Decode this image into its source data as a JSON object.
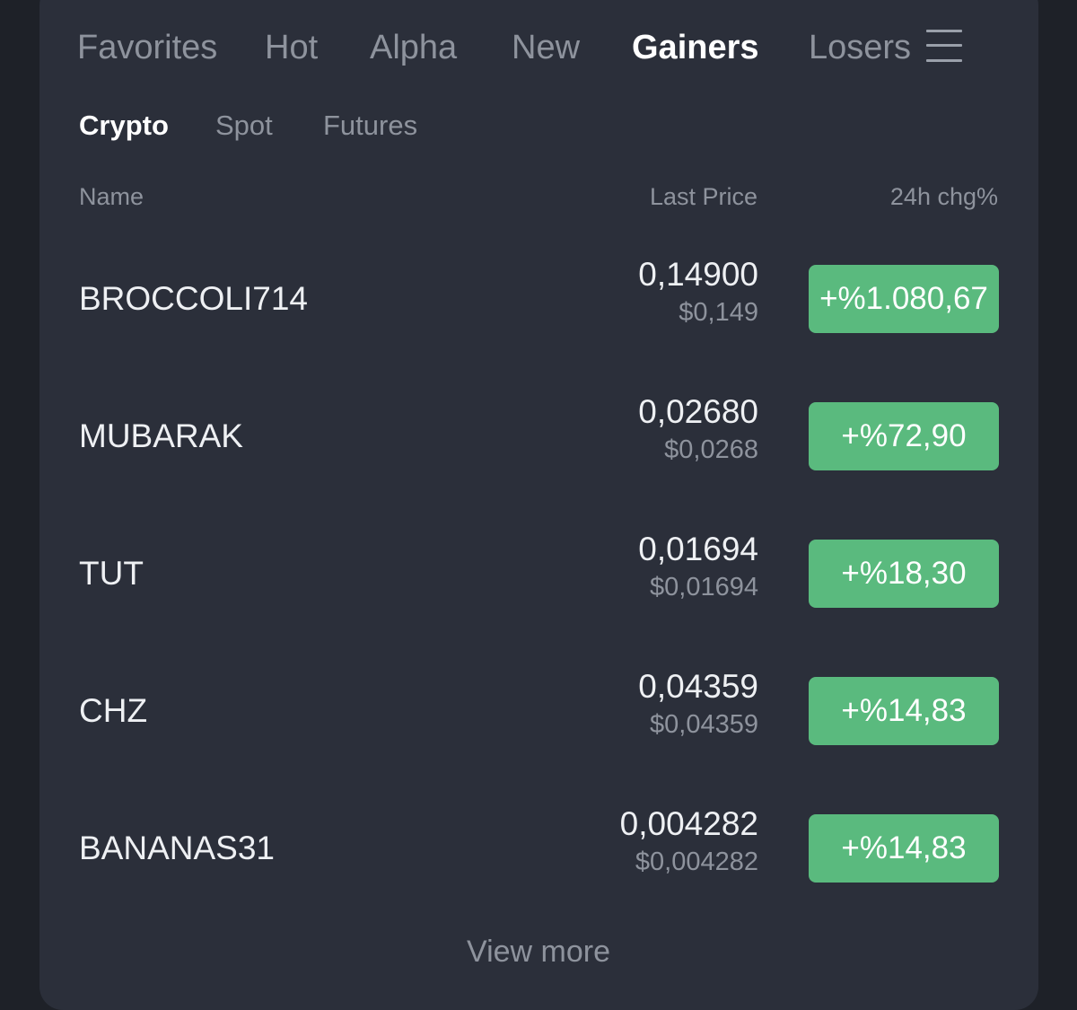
{
  "colors": {
    "background": "#1e2128",
    "card": "#2b2f3a",
    "positive_badge": "#5aba7e",
    "text_primary": "#eef0f3",
    "text_secondary": "#8e939d"
  },
  "top_tabs": [
    {
      "label": "Favorites",
      "active": false
    },
    {
      "label": "Hot",
      "active": false
    },
    {
      "label": "Alpha",
      "active": false
    },
    {
      "label": "New",
      "active": false
    },
    {
      "label": "Gainers",
      "active": true
    },
    {
      "label": "Losers",
      "active": false
    }
  ],
  "menu_icon": "hamburger-menu-icon",
  "sub_tabs": [
    {
      "label": "Crypto",
      "active": true
    },
    {
      "label": "Spot",
      "active": false
    },
    {
      "label": "Futures",
      "active": false
    }
  ],
  "columns": {
    "name": "Name",
    "last_price": "Last Price",
    "change": "24h chg%"
  },
  "rows": [
    {
      "name": "BROCCOLI714",
      "price": "0,14900",
      "usd": "$0,149",
      "change": "+%1.080,67"
    },
    {
      "name": "MUBARAK",
      "price": "0,02680",
      "usd": "$0,0268",
      "change": "+%72,90"
    },
    {
      "name": "TUT",
      "price": "0,01694",
      "usd": "$0,01694",
      "change": "+%18,30"
    },
    {
      "name": "CHZ",
      "price": "0,04359",
      "usd": "$0,04359",
      "change": "+%14,83"
    },
    {
      "name": "BANANAS31",
      "price": "0,004282",
      "usd": "$0,004282",
      "change": "+%14,83"
    }
  ],
  "view_more": "View more"
}
